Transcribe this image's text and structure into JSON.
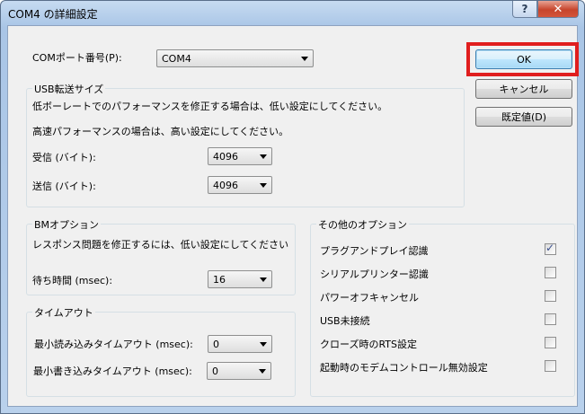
{
  "window": {
    "title": "COM4 の詳細設定",
    "help_glyph": "?",
    "close_glyph": "✕"
  },
  "port": {
    "label": "COMポート番号(P):",
    "value": "COM4"
  },
  "buttons": {
    "ok": "OK",
    "cancel": "キャンセル",
    "defaults": "既定値(D)"
  },
  "usb": {
    "title": "USB転送サイズ",
    "desc1": "低ボーレートでのパフォーマンスを修正する場合は、低い設定にしてください。",
    "desc2": "高速パフォーマンスの場合は、高い設定にしてください。",
    "receive_label": "受信 (バイト):",
    "receive_value": "4096",
    "send_label": "送信 (バイト):",
    "send_value": "4096"
  },
  "bm": {
    "title": "BMオプション",
    "desc": "レスポンス問題を修正するには、低い設定にしてください",
    "latency_label": "待ち時間 (msec):",
    "latency_value": "16"
  },
  "timeouts": {
    "title": "タイムアウト",
    "read_label": "最小読み込みタイムアウト (msec):",
    "read_value": "0",
    "write_label": "最小書き込みタイムアウト (msec):",
    "write_value": "0"
  },
  "misc": {
    "title": "その他のオプション",
    "check_glyph": "✓",
    "options": [
      {
        "label": "プラグアンドプレイ認識",
        "checked": true
      },
      {
        "label": "シリアルプリンター認識",
        "checked": false
      },
      {
        "label": "パワーオフキャンセル",
        "checked": false
      },
      {
        "label": "USB未接続",
        "checked": false
      },
      {
        "label": "クローズ時のRTS設定",
        "checked": false
      },
      {
        "label": "起動時のモデムコントロール無効設定",
        "checked": false
      }
    ]
  },
  "colors": {
    "highlight": "#e01e1e",
    "close_button": "#c7452c",
    "dialog_bg": "#f0f0f0"
  }
}
